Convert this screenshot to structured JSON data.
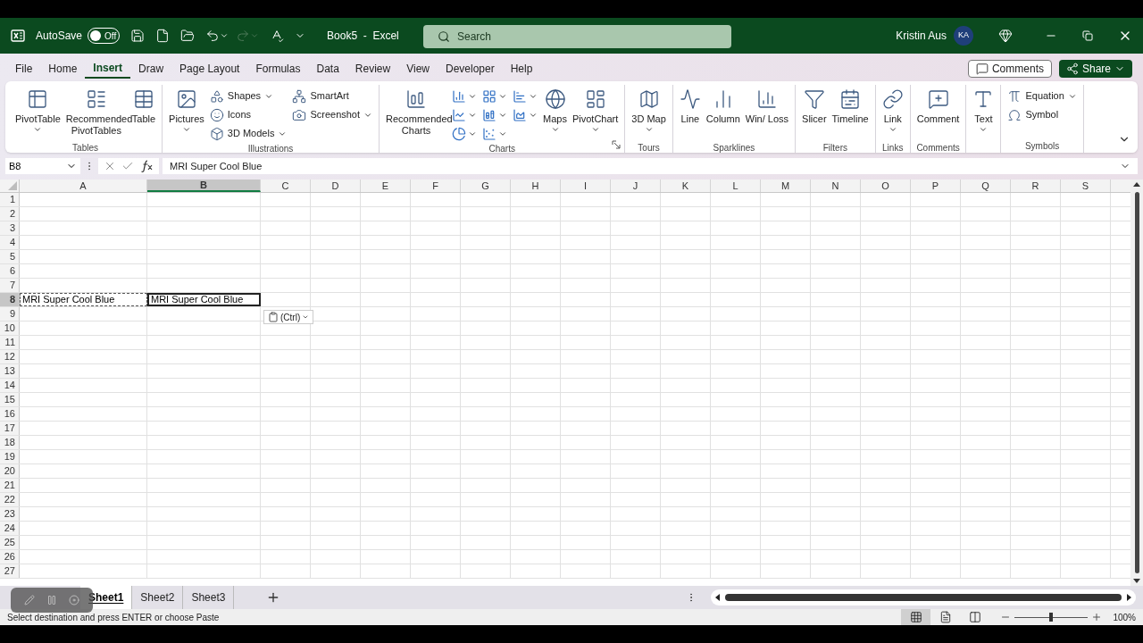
{
  "title_bar": {
    "autosave_label": "AutoSave",
    "autosave_toggle": {
      "label": "Off",
      "on": false
    },
    "redo_disabled": true,
    "document_title": "Book5  -  Excel",
    "search_placeholder": "Search",
    "user_name": "Kristin Aus",
    "avatar_initials": "KA"
  },
  "menu_tabs": [
    {
      "label": "File",
      "selected": false
    },
    {
      "label": "Home",
      "selected": false
    },
    {
      "label": "Insert",
      "selected": true
    },
    {
      "label": "Draw",
      "selected": false
    },
    {
      "label": "Page Layout",
      "selected": false
    },
    {
      "label": "Formulas",
      "selected": false
    },
    {
      "label": "Data",
      "selected": false
    },
    {
      "label": "Review",
      "selected": false
    },
    {
      "label": "View",
      "selected": false
    },
    {
      "label": "Developer",
      "selected": false
    },
    {
      "label": "Help",
      "selected": false
    }
  ],
  "comments_button": "Comments",
  "share_button": "Share",
  "ribbon": {
    "groups": [
      {
        "label": "Tables",
        "launcher": false,
        "columns": [
          [
            {
              "kind": "large",
              "label": "PivotTable",
              "dropdown": true
            }
          ],
          [
            {
              "kind": "large",
              "label": "Recommended PivotTables",
              "dropdown": false
            }
          ],
          [
            {
              "kind": "large",
              "label": "Table",
              "dropdown": false
            }
          ]
        ]
      },
      {
        "label": "Illustrations",
        "launcher": false,
        "columns": [
          [
            {
              "kind": "large",
              "label": "Pictures",
              "dropdown": true
            }
          ],
          [
            {
              "kind": "small",
              "label": "Shapes",
              "dropdown": true
            },
            {
              "kind": "small",
              "label": "Icons",
              "dropdown": false
            },
            {
              "kind": "small",
              "label": "3D Models",
              "dropdown": true
            }
          ],
          [
            {
              "kind": "small",
              "label": "SmartArt",
              "dropdown": false
            },
            {
              "kind": "small",
              "label": "Screenshot",
              "dropdown": true
            }
          ]
        ]
      },
      {
        "label": "Charts",
        "launcher": true,
        "columns": [
          [
            {
              "kind": "large",
              "label": "Recommended Charts",
              "dropdown": false
            }
          ],
          [
            {
              "kind": "icon",
              "dropdown": true
            },
            {
              "kind": "icon",
              "dropdown": true
            },
            {
              "kind": "icon",
              "dropdown": true
            }
          ],
          [
            {
              "kind": "icon",
              "dropdown": true
            },
            {
              "kind": "icon",
              "dropdown": true
            },
            {
              "kind": "icon",
              "dropdown": true
            }
          ],
          [
            {
              "kind": "icon",
              "dropdown": true
            },
            {
              "kind": "icon",
              "dropdown": true
            }
          ],
          [
            {
              "kind": "large",
              "label": "Maps",
              "dropdown": true
            }
          ],
          [
            {
              "kind": "large",
              "label": "PivotChart",
              "dropdown": true
            }
          ]
        ]
      },
      {
        "label": "Tours",
        "launcher": false,
        "columns": [
          [
            {
              "kind": "large",
              "label": "3D Map",
              "dropdown": true
            }
          ]
        ]
      },
      {
        "label": "Sparklines",
        "launcher": false,
        "columns": [
          [
            {
              "kind": "large",
              "label": "Line",
              "dropdown": false
            }
          ],
          [
            {
              "kind": "large",
              "label": "Column",
              "dropdown": false
            }
          ],
          [
            {
              "kind": "large",
              "label": "Win/ Loss",
              "dropdown": false
            }
          ]
        ]
      },
      {
        "label": "Filters",
        "launcher": false,
        "columns": [
          [
            {
              "kind": "large",
              "label": "Slicer",
              "dropdown": false
            }
          ],
          [
            {
              "kind": "large",
              "label": "Timeline",
              "dropdown": false
            }
          ]
        ]
      },
      {
        "label": "Links",
        "launcher": false,
        "columns": [
          [
            {
              "kind": "large",
              "label": "Link",
              "dropdown": true
            }
          ]
        ]
      },
      {
        "label": "Comments",
        "launcher": false,
        "columns": [
          [
            {
              "kind": "large",
              "label": "Comment",
              "dropdown": false
            }
          ]
        ]
      },
      {
        "launcher": false,
        "columns": [
          [
            {
              "kind": "large",
              "label": "Text",
              "dropdown": true
            }
          ]
        ]
      },
      {
        "label": "Symbols",
        "launcher": false,
        "columns": [
          [
            {
              "kind": "small",
              "label": "Equation",
              "dropdown": true
            },
            {
              "kind": "small",
              "label": "Symbol",
              "dropdown": false
            }
          ]
        ]
      }
    ]
  },
  "formula_bar": {
    "name_box": "B8",
    "formula": "MRI Super Cool Blue"
  },
  "sheet": {
    "columns": [
      {
        "label": "A",
        "selected": false
      },
      {
        "label": "B",
        "selected": true
      },
      {
        "label": "C",
        "selected": false
      },
      {
        "label": "D",
        "selected": false
      },
      {
        "label": "E",
        "selected": false
      },
      {
        "label": "F",
        "selected": false
      },
      {
        "label": "G",
        "selected": false
      },
      {
        "label": "H",
        "selected": false
      },
      {
        "label": "I",
        "selected": false
      },
      {
        "label": "J",
        "selected": false
      },
      {
        "label": "K",
        "selected": false
      },
      {
        "label": "L",
        "selected": false
      },
      {
        "label": "M",
        "selected": false
      },
      {
        "label": "N",
        "selected": false
      },
      {
        "label": "O",
        "selected": false
      },
      {
        "label": "P",
        "selected": false
      },
      {
        "label": "Q",
        "selected": false
      },
      {
        "label": "R",
        "selected": false
      },
      {
        "label": "S",
        "selected": false
      }
    ],
    "rows": [
      {
        "label": "1",
        "selected": false
      },
      {
        "label": "2",
        "selected": false
      },
      {
        "label": "3",
        "selected": false
      },
      {
        "label": "4",
        "selected": false
      },
      {
        "label": "5",
        "selected": false
      },
      {
        "label": "6",
        "selected": false
      },
      {
        "label": "7",
        "selected": false
      },
      {
        "label": "8",
        "selected": true,
        "cells": [
          {
            "text": "MRI Super Cool Blue",
            "kind": "copy_source"
          },
          {
            "text": "MRI Super Cool Blue",
            "kind": "active"
          }
        ]
      },
      {
        "label": "9",
        "selected": false
      },
      {
        "label": "10",
        "selected": false
      },
      {
        "label": "11",
        "selected": false
      },
      {
        "label": "12",
        "selected": false
      },
      {
        "label": "13",
        "selected": false
      },
      {
        "label": "14",
        "selected": false
      },
      {
        "label": "15",
        "selected": false
      },
      {
        "label": "16",
        "selected": false
      },
      {
        "label": "17",
        "selected": false
      },
      {
        "label": "18",
        "selected": false
      },
      {
        "label": "19",
        "selected": false
      },
      {
        "label": "20",
        "selected": false
      },
      {
        "label": "21",
        "selected": false
      },
      {
        "label": "22",
        "selected": false
      },
      {
        "label": "23",
        "selected": false
      },
      {
        "label": "24",
        "selected": false
      },
      {
        "label": "25",
        "selected": false
      },
      {
        "label": "26",
        "selected": false
      },
      {
        "label": "27",
        "selected": false
      }
    ]
  },
  "paste_options": {
    "label": "(Ctrl)"
  },
  "sheet_tabs": [
    {
      "label": "Sheet1",
      "selected": true
    },
    {
      "label": "Sheet2",
      "selected": false
    },
    {
      "label": "Sheet3",
      "selected": false
    }
  ],
  "status_bar": {
    "message": "Select destination and press ENTER or choose Paste",
    "views": [
      {
        "selected": true
      },
      {
        "selected": false
      },
      {
        "selected": false
      }
    ],
    "zoom": {
      "level": 0.5,
      "reading": "100%"
    }
  }
}
